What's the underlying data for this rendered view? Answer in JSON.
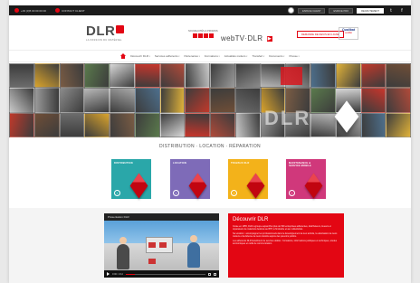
{
  "colors": {
    "brand_red": "#e30613",
    "dark": "#1b1b1b",
    "purple": "#7e6bb8",
    "teal": "#2aa7a9",
    "yellow": "#f3b21a",
    "pink": "#d0387b"
  },
  "topbar": {
    "phone": "+33 (0)5 00 00 00 00",
    "contact": "CONTACT CLIENT",
    "icon_round": "globe-icon",
    "btn1": "ESPACE CLIENT",
    "btn2": "ESPACE PRO",
    "btn3": "RECRUTEMENT",
    "social1": "t",
    "social2": "f"
  },
  "header": {
    "logo_word": "DLR",
    "logo_tag": "LA PASSION DU MATÉRIEL",
    "promo_small": "NOUVEAUTÉS & PROMOS",
    "webtv": "webTV·DLR",
    "webtv_badge": "▶",
    "red_button": "DEMANDE DE DEVIS EN LIGNE",
    "badge_title": "Qualibat",
    "badge_sub": "certifié"
  },
  "nav": {
    "items": [
      "Découvrir DLR",
      "Services adhérents",
      "Partenaires",
      "Formations",
      "Actualités métiers",
      "Transfert",
      "Documents",
      "Presse"
    ]
  },
  "hero": {
    "overlay": "DLR"
  },
  "section": {
    "title": "DISTRIBUTION · LOCATION · RÉPARATION"
  },
  "cards": [
    {
      "label": "DISTRIBUTION",
      "color": "#2aa7a9"
    },
    {
      "label": "LOCATION",
      "color": "#7e6bb8"
    },
    {
      "label": "TRAVAUX DLR",
      "color": "#f3b21a"
    },
    {
      "label": "MAINTENANCE & SERVICE MOBILE",
      "color": "#d0387b"
    }
  ],
  "video": {
    "title": "Présentation DLR",
    "time": "0:00 / 2:14",
    "progress": 0.12
  },
  "discover": {
    "title": "Découvrir DLR",
    "p1": "Créée en 1955, DLR regroupe aujourd'hui plus de 500 entreprises adhérentes, distributeurs, loueurs et réparateurs de matériels destinés au BTP, à l'industrie et aux collectivités.",
    "p2": "Sa vocation : accompagner les professionnels dans le développement de leur activité, la valorisation de leurs métiers et la défense de leurs intérêts auprès des pouvoirs publics.",
    "p3": "Les adhérents DLR bénéficient de services dédiés : formations, informations juridiques et techniques, études économiques et outils de communication."
  }
}
